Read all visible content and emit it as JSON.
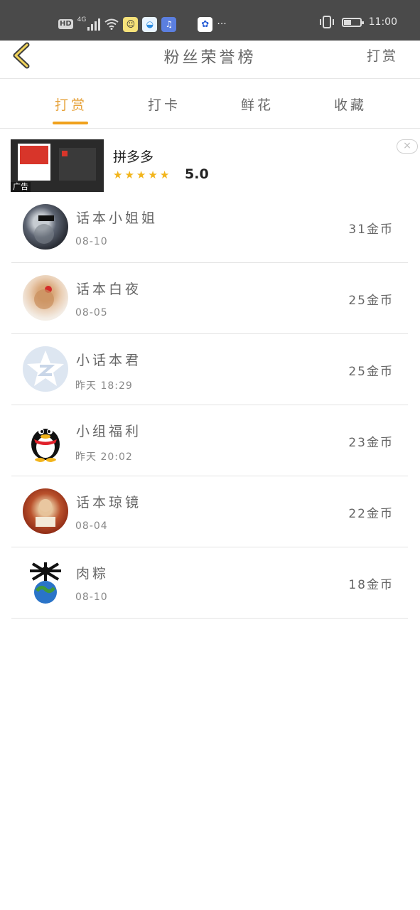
{
  "status_bar": {
    "network": "HD",
    "signal_type": "4G",
    "overflow": "···",
    "time": "11:00",
    "icons": [
      "vibrate-icon",
      "battery-icon"
    ]
  },
  "header": {
    "title": "粉丝荣誉榜",
    "action": "打赏"
  },
  "tabs": [
    {
      "label": "打赏",
      "active": true
    },
    {
      "label": "打卡",
      "active": false
    },
    {
      "label": "鲜花",
      "active": false
    },
    {
      "label": "收藏",
      "active": false
    }
  ],
  "ad": {
    "tag": "广告",
    "name": "拼多多",
    "stars": 5,
    "rating": "5.0",
    "close": "×"
  },
  "fans": [
    {
      "name": "话本小姐姐",
      "date": "08-10",
      "coins": "31金币"
    },
    {
      "name": "话本白夜",
      "date": "08-05",
      "coins": "25金币"
    },
    {
      "name": "小话本君",
      "date": "昨天 18:29",
      "coins": "25金币"
    },
    {
      "name": "小组福利",
      "date": "昨天 20:02",
      "coins": "23金币"
    },
    {
      "name": "话本琼镜",
      "date": "08-04",
      "coins": "22金币"
    },
    {
      "name": "肉粽",
      "date": "08-10",
      "coins": "18金币"
    }
  ],
  "colors": {
    "accent": "#f0a11c",
    "status_bar_bg": "#4a4a4a",
    "star": "#f2b51c"
  }
}
